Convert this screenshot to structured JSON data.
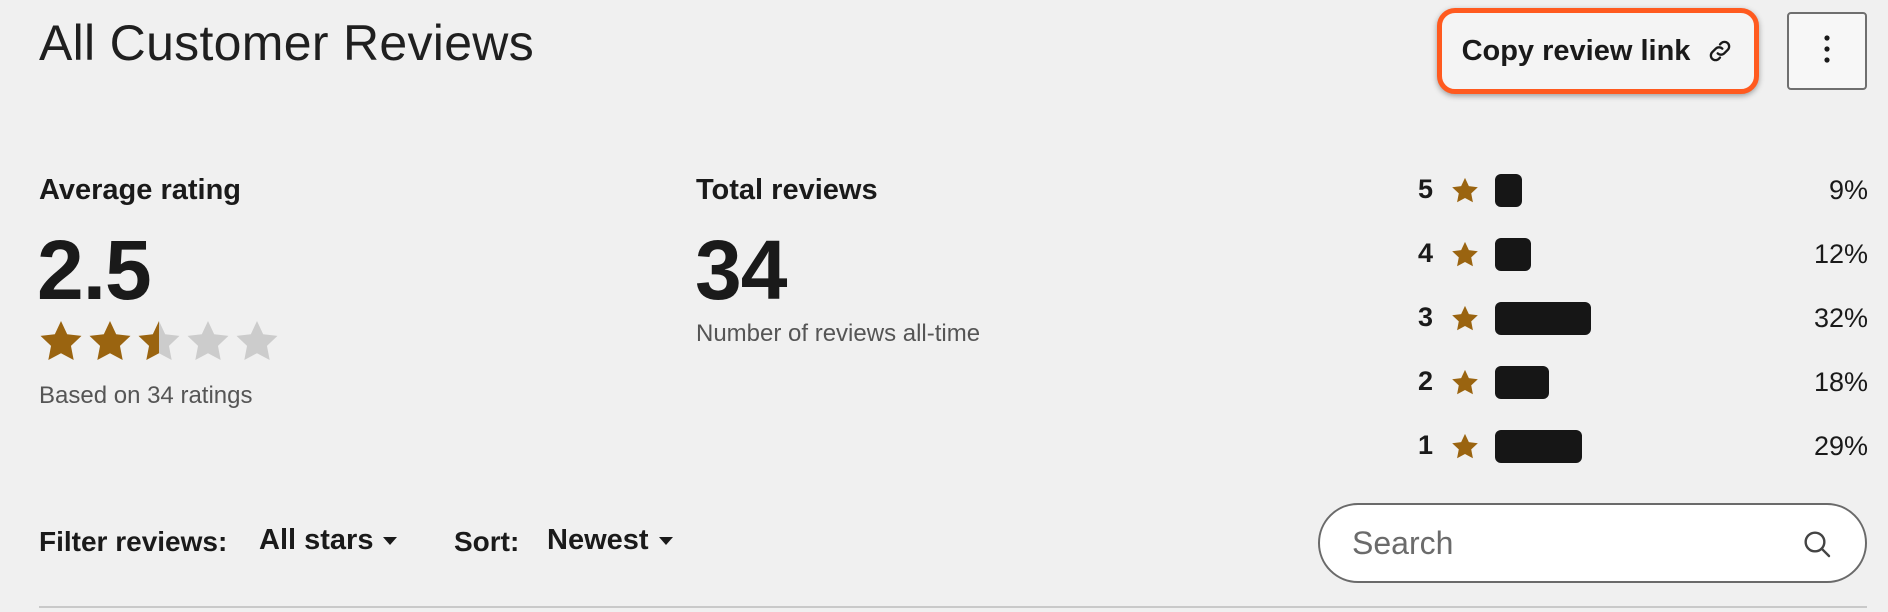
{
  "header": {
    "title": "All Customer Reviews",
    "copy_link_label": "Copy review link",
    "more_icon": "vertical-ellipsis-icon"
  },
  "average": {
    "label": "Average rating",
    "value": "2.5",
    "rating": 2.5,
    "max_stars": 5,
    "based_on": "Based on 34 ratings"
  },
  "total": {
    "label": "Total reviews",
    "value": "34",
    "sub": "Number of reviews all-time"
  },
  "distribution": [
    {
      "stars": "5",
      "percent": "9%",
      "fraction": 0.09
    },
    {
      "stars": "4",
      "percent": "12%",
      "fraction": 0.12
    },
    {
      "stars": "3",
      "percent": "32%",
      "fraction": 0.32
    },
    {
      "stars": "2",
      "percent": "18%",
      "fraction": 0.18
    },
    {
      "stars": "1",
      "percent": "29%",
      "fraction": 0.29
    }
  ],
  "filters": {
    "filter_label": "Filter reviews:",
    "filter_value": "All stars",
    "sort_label": "Sort:",
    "sort_value": "Newest"
  },
  "search": {
    "placeholder": "Search"
  },
  "colors": {
    "accent_star": "#9a6410",
    "empty_star": "#cccccc",
    "highlight_border": "#ff5a1f",
    "bar": "#161616"
  }
}
